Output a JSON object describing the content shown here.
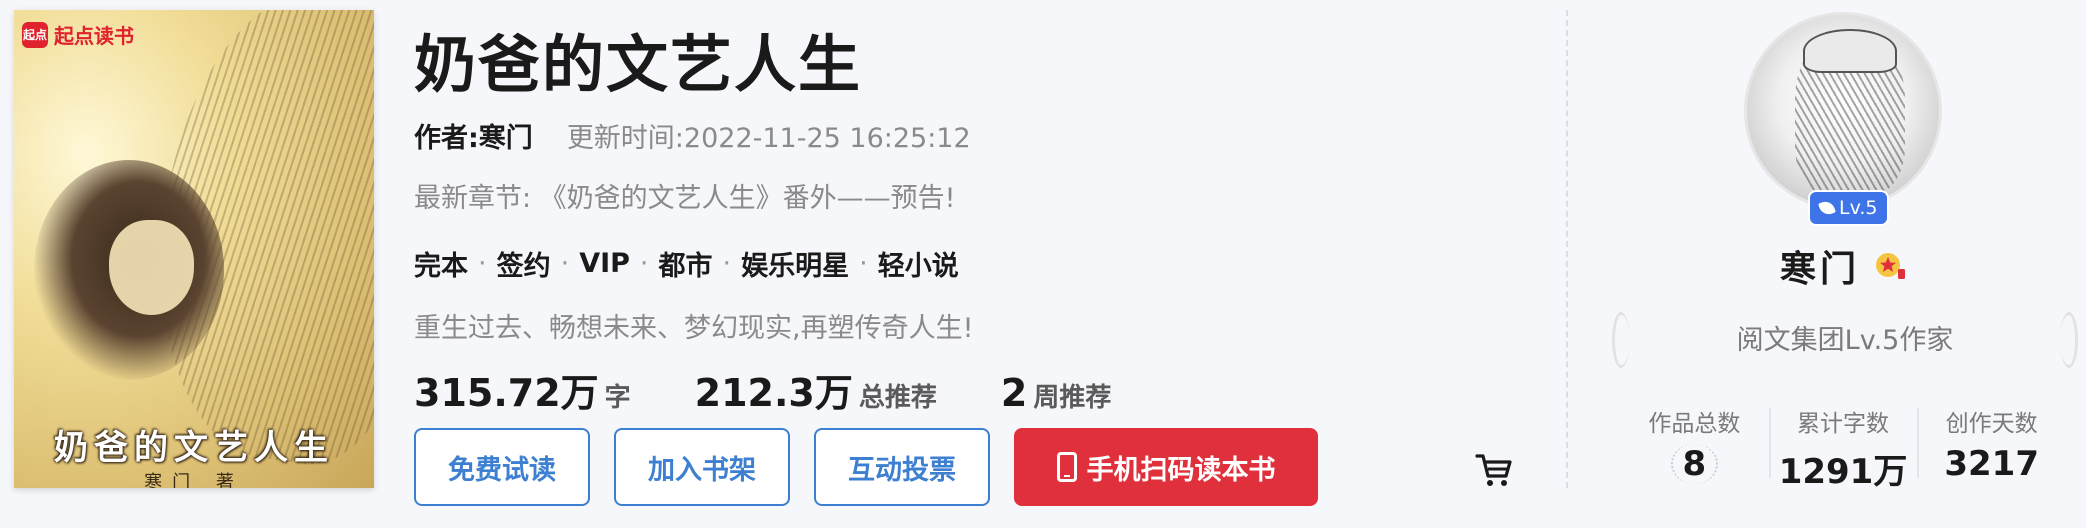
{
  "book": {
    "cover": {
      "brand": "起点读书",
      "brand_mark": "起点",
      "title": "奶爸的文艺人生",
      "author": "寒门 著"
    },
    "title": "奶爸的文艺人生",
    "author": "作者:寒门",
    "update_time": "更新时间:2022-11-25 16:25:12",
    "latest_chapter": "最新章节: 《奶爸的文艺人生》番外——预告!",
    "tags": [
      "完本",
      "签约",
      "VIP",
      "都市",
      "娱乐明星",
      "轻小说"
    ],
    "intro": "重生过去、畅想未来、梦幻现实,再塑传奇人生!",
    "stats": {
      "words_num": "315.72万",
      "words_unit": "字",
      "total_rec_num": "212.3万",
      "total_rec_unit": "总推荐",
      "week_rec_num": "2",
      "week_rec_unit": "周推荐"
    },
    "buttons": {
      "free_read": "免费试读",
      "add_shelf": "加入书架",
      "vote": "互动投票",
      "scan_read": "手机扫码读本书"
    },
    "icons": [
      "phone-icon",
      "cart-icon"
    ]
  },
  "author_panel": {
    "level_badge": "Lv.5",
    "name": "寒门",
    "title": "阅文集团Lv.5作家",
    "stats": [
      {
        "label": "作品总数",
        "value": "8"
      },
      {
        "label": "累计字数",
        "value": "1291万"
      },
      {
        "label": "创作天数",
        "value": "3217"
      }
    ],
    "icons": [
      "feather-icon",
      "star-medal-icon"
    ]
  },
  "colors": {
    "accent_blue": "#3d7fd0",
    "accent_red": "#e0303c",
    "level_blue": "#3f74e8",
    "background": "#f6f7fb"
  }
}
